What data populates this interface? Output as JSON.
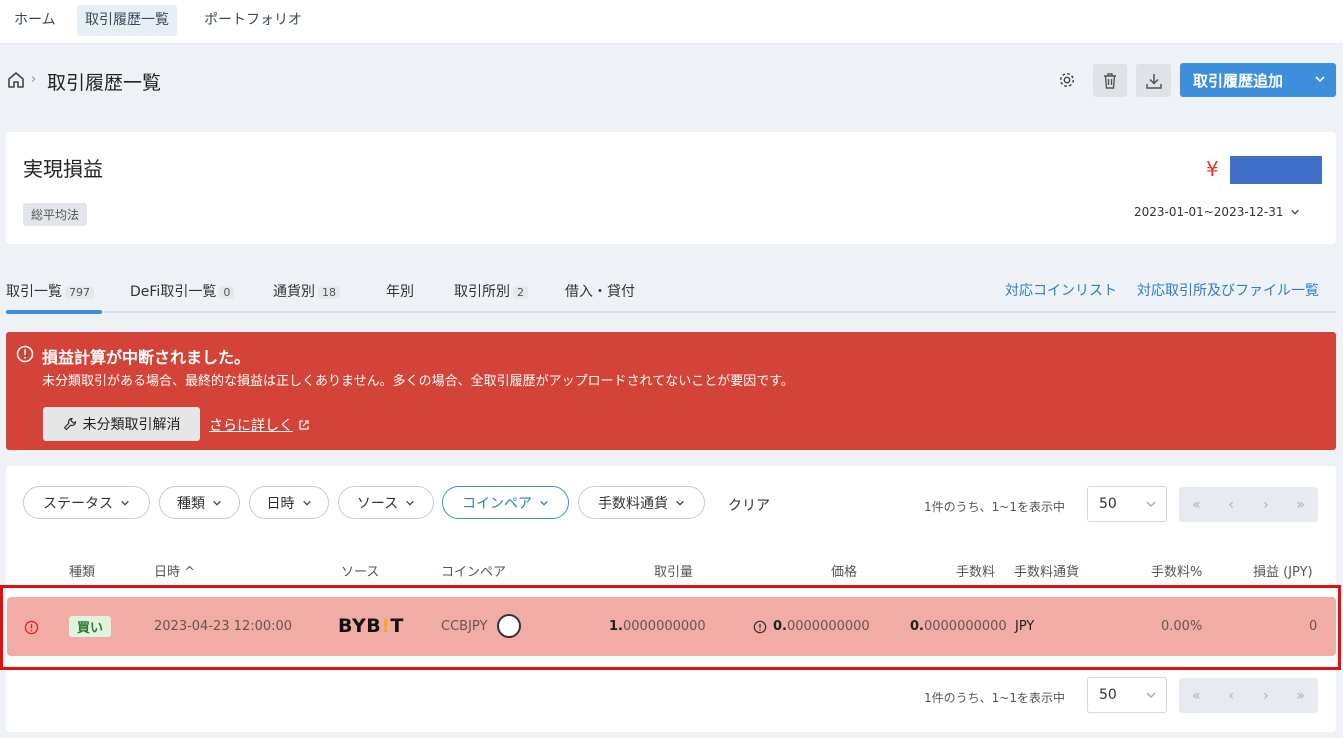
{
  "nav": {
    "home": "ホーム",
    "history": "取引履歴一覧",
    "portfolio": "ポートフォリオ"
  },
  "header": {
    "title": "取引履歴一覧",
    "add_button": "取引履歴追加"
  },
  "summary": {
    "title": "実現損益",
    "method": "総平均法",
    "currency_symbol": "¥",
    "date_range": "2023-01-01~2023-12-31"
  },
  "tabs": [
    {
      "label": "取引一覧",
      "count": "797"
    },
    {
      "label": "DeFi取引一覧",
      "count": "0"
    },
    {
      "label": "通貨別",
      "count": "18"
    },
    {
      "label": "年別",
      "count": ""
    },
    {
      "label": "取引所別",
      "count": "2"
    },
    {
      "label": "借入・貸付",
      "count": ""
    }
  ],
  "links": {
    "coins": "対応コインリスト",
    "exchanges": "対応取引所及びファイル一覧"
  },
  "alert": {
    "title": "損益計算が中断されました。",
    "message": "未分類取引がある場合、最終的な損益は正しくありません。多くの場合、全取引履歴がアップロードされてないことが要因です。",
    "fix_button": "未分類取引解消",
    "more_link": "さらに詳しく"
  },
  "filters": [
    "ステータス",
    "種類",
    "日時",
    "ソース",
    "コインペア",
    "手数料通貨"
  ],
  "clear": "クリア",
  "pagination": {
    "info": "1件のうち、1~1を表示中",
    "per_page": "50"
  },
  "columns": [
    "種類",
    "日時 ^",
    "ソース",
    "コインペア",
    "取引量",
    "価格",
    "手数料",
    "手数料通貨",
    "手数料%",
    "損益 (JPY)"
  ],
  "row": {
    "type": "買い",
    "datetime": "2023-04-23 12:00:00",
    "source_a": "BYB",
    "source_b": "!",
    "source_c": "T",
    "pair": "CCBJPY",
    "amount_int": "1.",
    "amount_dec": "0000000000",
    "price_int": "0.",
    "price_dec": "0000000000",
    "fee_int": "0.",
    "fee_dec": "0000000000",
    "fee_currency": "JPY",
    "fee_pct": "0.00%",
    "pnl": "0"
  }
}
